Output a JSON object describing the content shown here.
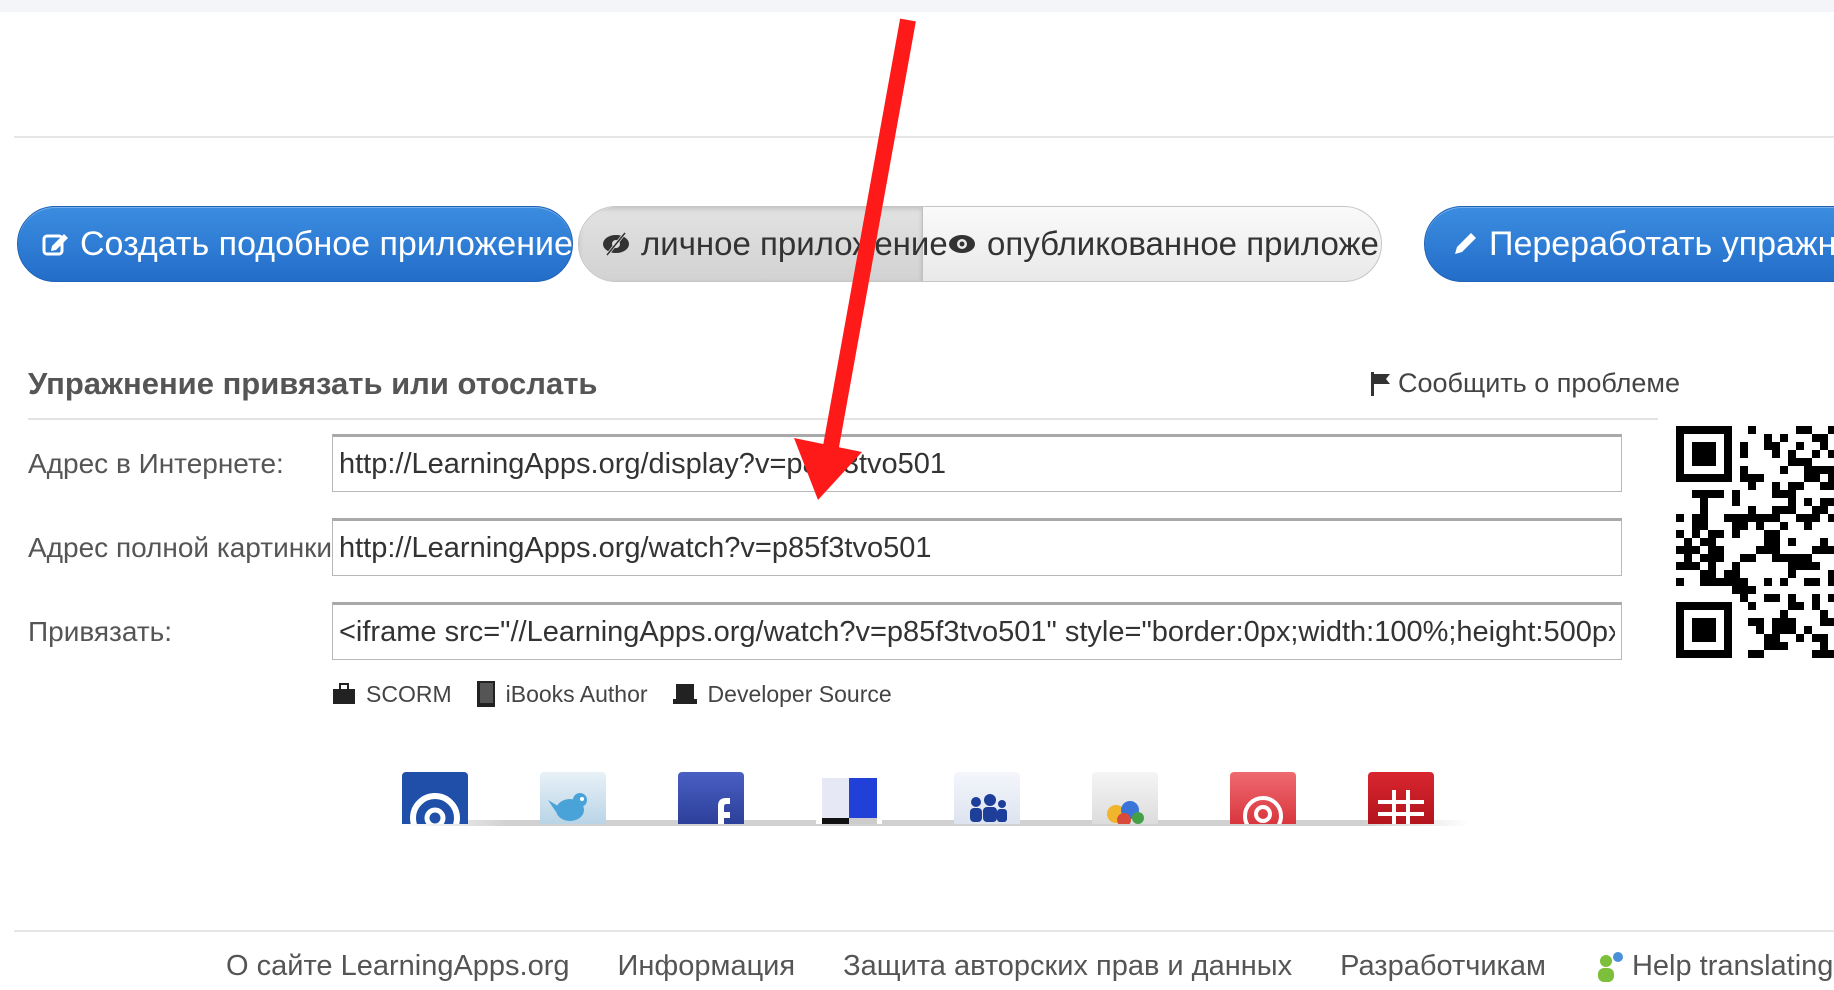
{
  "toolbar": {
    "create_label": "Создать подобное приложение",
    "private_label": "личное приложение",
    "public_label": "опубликованное приложение",
    "rework_label": "Переработать упражнение"
  },
  "section": {
    "title": "Упражнение привязать или отослать",
    "report_label": "Сообщить о проблеме"
  },
  "fields": {
    "internet_label": "Адрес в Интернете:",
    "internet_value": "http://LearningApps.org/display?v=p85f3tvo501",
    "fullscreen_label": "Адрес полной картинки:",
    "fullscreen_value": "http://LearningApps.org/watch?v=p85f3tvo501",
    "embed_label": "Привязать:",
    "embed_value": "<iframe src=\"//LearningApps.org/watch?v=p85f3tvo501\" style=\"border:0px;width:100%;height:500px\" webkitallowfullscreen=\"true\"></iframe>"
  },
  "export": {
    "scorm": "SCORM",
    "ibooks": "iBooks Author",
    "developer": "Developer Source"
  },
  "share": [
    {
      "name": "email",
      "color": "#1f4fa8"
    },
    {
      "name": "twitter",
      "color": "#cfe3ef"
    },
    {
      "name": "facebook",
      "color": "#3b4fb0"
    },
    {
      "name": "delicious",
      "color": "#2b4fd8"
    },
    {
      "name": "myspace",
      "color": "#dfe6f3"
    },
    {
      "name": "google-buzz",
      "color": "#e8e8e8"
    },
    {
      "name": "pinterest",
      "color": "#e0444c"
    },
    {
      "name": "grid",
      "color": "#c81a24"
    }
  ],
  "footer": {
    "about": "О сайте LearningApps.org",
    "info": "Информация",
    "privacy": "Защита авторских прав и данных",
    "developers": "Разработчикам",
    "help": "Help translating"
  },
  "colors": {
    "primary": "#2a78d6",
    "annotation_arrow": "#ff1a1a"
  }
}
